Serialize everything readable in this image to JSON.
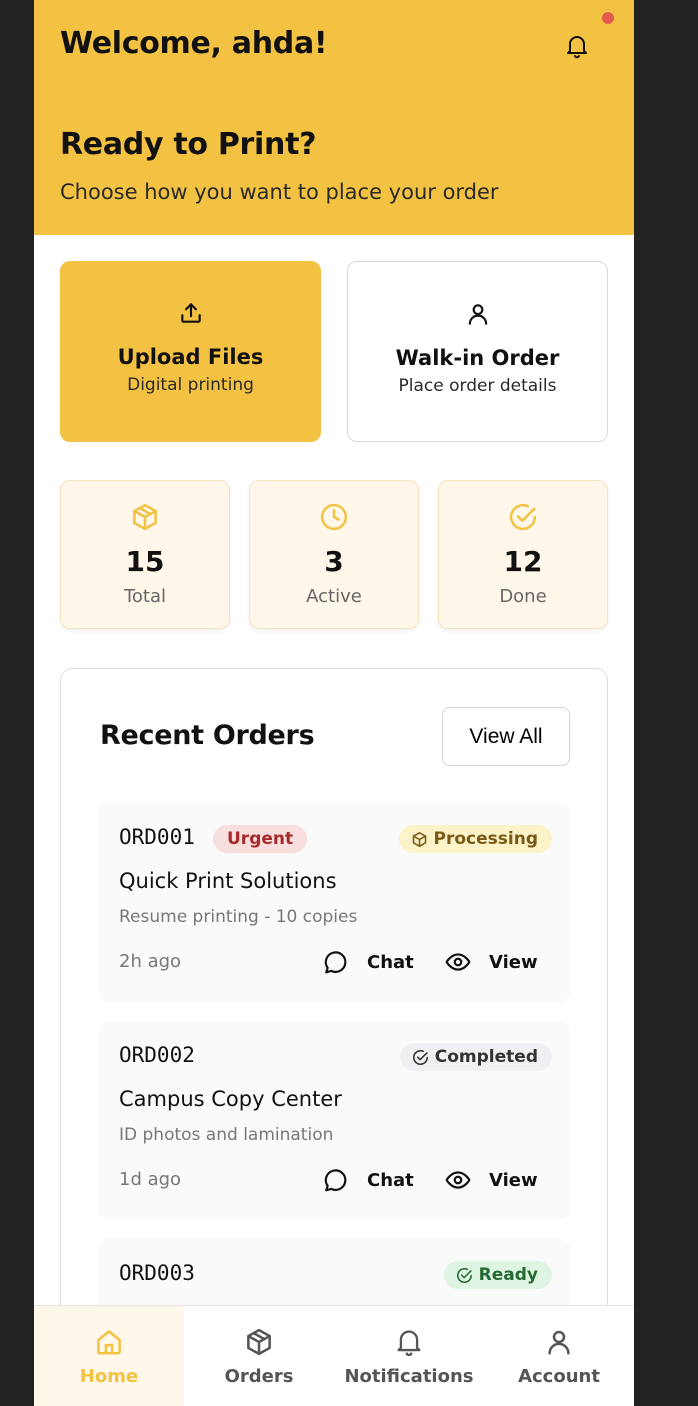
{
  "header": {
    "welcome": "Welcome, ahda!",
    "hero_title": "Ready to Print?",
    "hero_subtitle": "Choose how you want to place your order"
  },
  "order_types": [
    {
      "title": "Upload Files",
      "subtitle": "Digital printing",
      "icon": "upload-icon"
    },
    {
      "title": "Walk-in Order",
      "subtitle": "Place order details",
      "icon": "user-icon"
    }
  ],
  "stats": [
    {
      "value": "15",
      "label": "Total",
      "icon": "package-icon"
    },
    {
      "value": "3",
      "label": "Active",
      "icon": "clock-icon"
    },
    {
      "value": "12",
      "label": "Done",
      "icon": "check-circle-icon"
    }
  ],
  "recent": {
    "title": "Recent Orders",
    "view_all": "View All",
    "orders": [
      {
        "id": "ORD001",
        "priority": "Urgent",
        "status": "Processing",
        "shop": "Quick Print Solutions",
        "description": "Resume printing - 10 copies",
        "time": "2h ago",
        "chat": "Chat",
        "view": "View"
      },
      {
        "id": "ORD002",
        "status": "Completed",
        "shop": "Campus Copy Center",
        "description": "ID photos and lamination",
        "time": "1d ago",
        "chat": "Chat",
        "view": "View"
      },
      {
        "id": "ORD003",
        "status": "Ready"
      }
    ]
  },
  "nav": [
    {
      "label": "Home",
      "icon": "home-icon",
      "active": true
    },
    {
      "label": "Orders",
      "icon": "package-icon"
    },
    {
      "label": "Notifications",
      "icon": "bell-icon"
    },
    {
      "label": "Account",
      "icon": "user-icon"
    }
  ],
  "colors": {
    "accent": "#F4C242",
    "notification_dot": "#E45A4E",
    "urgent_bg": "#F9DEDE",
    "urgent_text": "#A52A2A",
    "processing_bg": "#FCF3C9",
    "completed_bg": "#EEF0F4",
    "ready_bg": "#DDF5E2",
    "ready_text": "#256A32"
  }
}
